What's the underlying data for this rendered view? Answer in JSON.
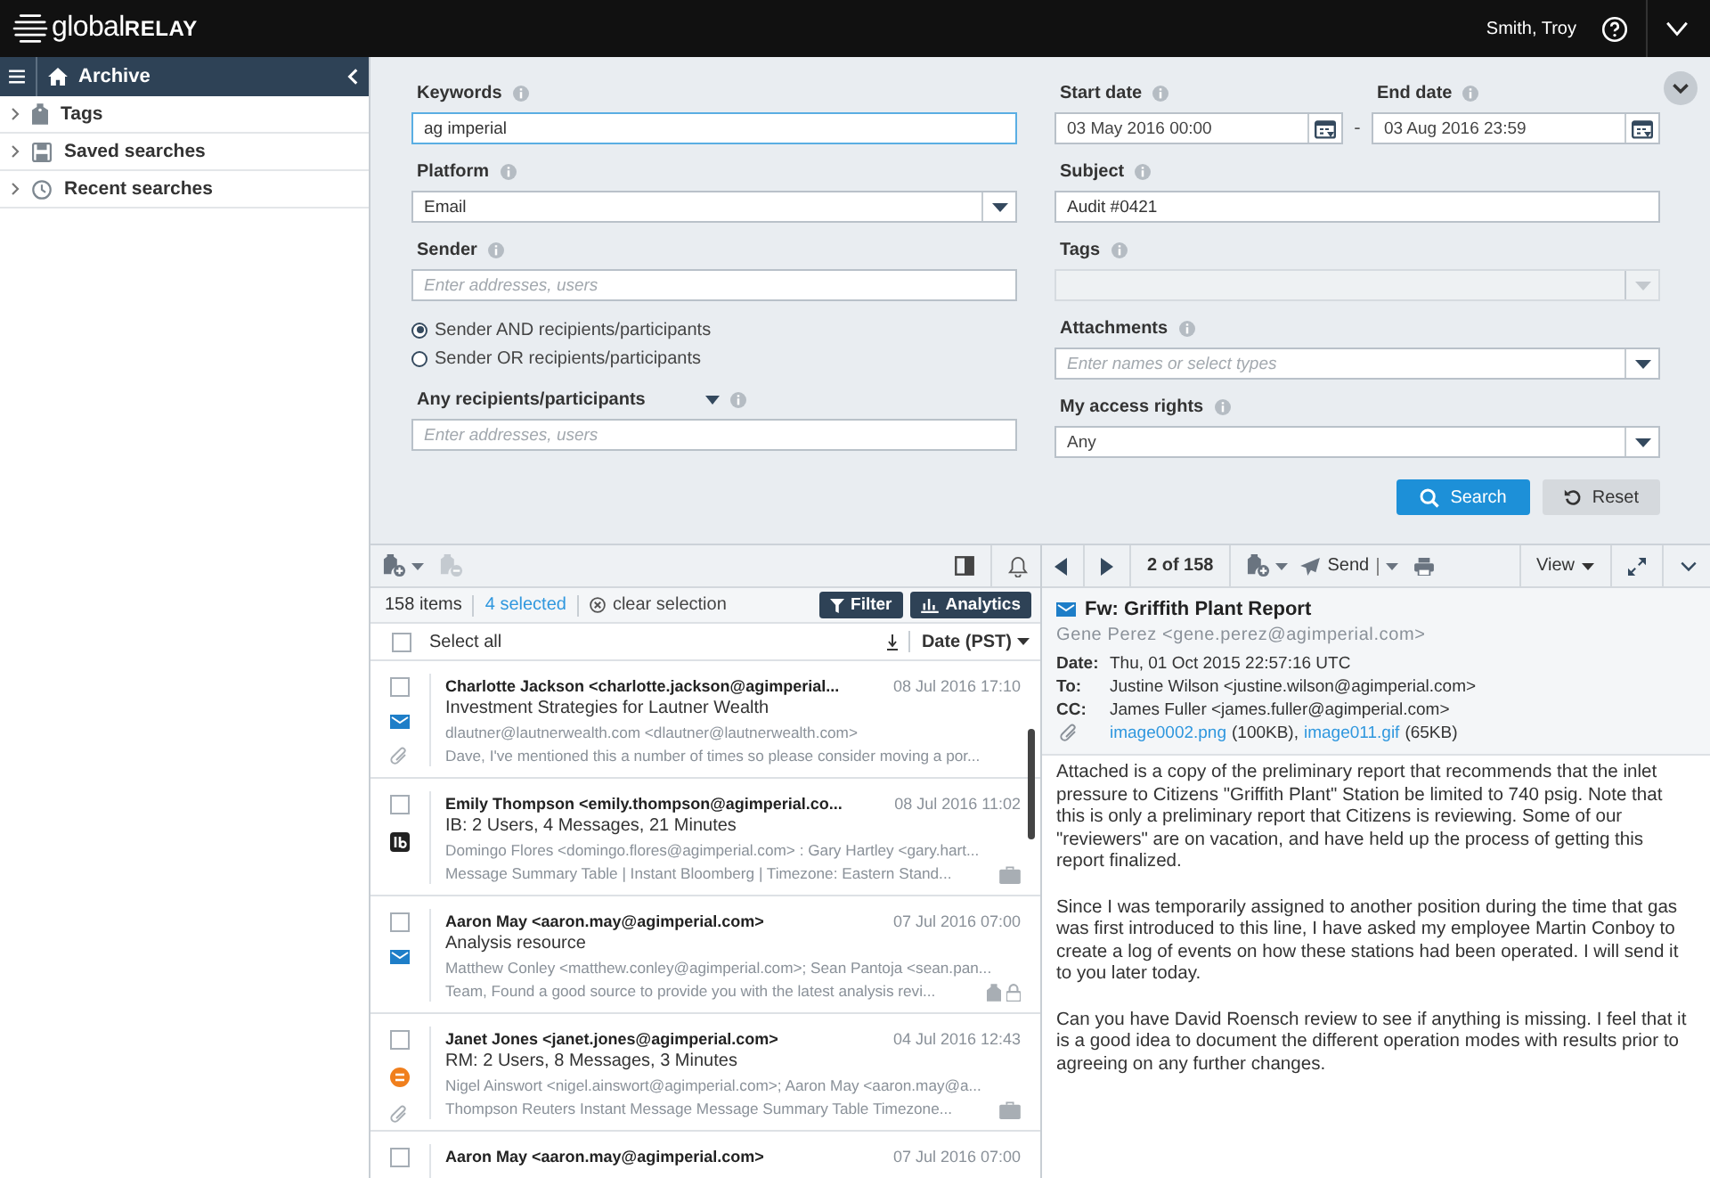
{
  "app": {
    "logo": [
      "global",
      "RELAY"
    ],
    "user": "Smith, Troy"
  },
  "sidebar": {
    "title": "Archive",
    "items": [
      {
        "label": "Tags",
        "kind": "tag",
        "expanded": false
      },
      {
        "label": "Saved searches",
        "kind": "disk",
        "expanded": false
      },
      {
        "label": "Recent searches",
        "kind": "clock",
        "expanded": false
      }
    ]
  },
  "search": {
    "columns": [
      [
        {
          "kind": "text",
          "label": "Keywords",
          "value": "ag imperial",
          "focused": true
        },
        {
          "kind": "select",
          "label": "Platform",
          "value": "Email",
          "disabled": false
        },
        {
          "kind": "text",
          "label": "Sender",
          "placeholder": "Enter addresses, users",
          "focused": false
        },
        {
          "kind": "radios",
          "options": [
            {
              "label": "Sender AND recipients/participants",
              "selected": true
            },
            {
              "label": "Sender OR recipients/participants",
              "selected": false
            }
          ]
        },
        {
          "kind": "text",
          "label": "Any recipients/participants",
          "placeholder": "Enter addresses, users",
          "focused": false,
          "label_menu": true
        }
      ],
      [
        {
          "kind": "dates",
          "separator": "-",
          "items": [
            {
              "label": "Start date",
              "value": "03 May 2016 00:00"
            },
            {
              "label": "End date",
              "value": "03 Aug 2016 23:59"
            }
          ]
        },
        {
          "kind": "text",
          "label": "Subject",
          "value": "Audit #0421",
          "focused": false
        },
        {
          "kind": "select",
          "label": "Tags",
          "disabled": true
        },
        {
          "kind": "select",
          "label": "Attachments",
          "placeholder": "Enter names or select types",
          "disabled": false
        },
        {
          "kind": "select",
          "label": "My access rights",
          "value": "Any",
          "disabled": false
        }
      ]
    ],
    "buttons": [
      {
        "kind": "search",
        "label": "Search"
      },
      {
        "kind": "reset",
        "label": "Reset"
      }
    ]
  },
  "list": {
    "count": "158 items",
    "selected_count": "4 selected",
    "clear": "clear selection",
    "filter": "Filter",
    "analytics": "Analytics",
    "select_all": {
      "label": "Select all",
      "checked": false
    },
    "sort": "Date (PST)",
    "rows": [
      {
        "kind": "email",
        "checked": false,
        "attachment": true,
        "sender": "Charlotte Jackson <charlotte.jackson@agimperial...",
        "date": "08 Jul 2016 17:10",
        "subject": "Investment Strategies for Lautner Wealth",
        "recipients": "dlautner@lautnerwealth.com <dlautner@lautnerwealth.com>",
        "preview": "Dave, I've mentioned this a number of times so please consider moving a por...",
        "markers": []
      },
      {
        "kind": "chat",
        "checked": false,
        "attachment": false,
        "sender": "Emily Thompson <emily.thompson@agimperial.co...",
        "date": "08 Jul 2016 11:02",
        "subject": "IB: 2 Users, 4 Messages, 21 Minutes",
        "recipients": "Domingo Flores <domingo.flores@agimperial.com> : Gary Hartley <gary.hart...",
        "preview": "Message Summary Table | Instant Bloomberg | Timezone: Eastern Stand...",
        "markers": [
          {
            "kind": "briefcase"
          }
        ]
      },
      {
        "kind": "email",
        "checked": false,
        "attachment": false,
        "sender": "Aaron May <aaron.may@agimperial.com>",
        "date": "07 Jul 2016 07:00",
        "subject": "Analysis resource",
        "recipients": "Matthew Conley <matthew.conley@agimperial.com>; Sean Pantoja <sean.pan...",
        "preview": "Team, Found a good source to provide you with the latest analysis revi...",
        "markers": [
          {
            "kind": "tag"
          },
          {
            "kind": "lock"
          }
        ]
      },
      {
        "kind": "circle",
        "checked": false,
        "attachment": true,
        "sender": "Janet Jones <janet.jones@agimperial.com>",
        "date": "04 Jul 2016 12:43",
        "subject": "RM: 2 Users, 8 Messages, 3 Minutes",
        "recipients": "Nigel Ainswort <nigel.ainswort@agimperial.com>; Aaron May <aaron.may@a...",
        "preview": "Thompson Reuters Instant Message Message Summary Table Timezone...",
        "markers": [
          {
            "kind": "briefcase"
          }
        ]
      },
      {
        "checked": false,
        "sender": "Aaron May <aaron.may@agimperial.com>",
        "date": "07 Jul 2016 07:00"
      }
    ]
  },
  "reader": {
    "position": "2 of 158",
    "send": "Send",
    "view": "View",
    "subject": "Fw: Griffith Plant Report",
    "from": "Gene Perez <gene.perez@agimperial.com>",
    "meta": [
      {
        "label": "Date:",
        "value": "Thu, 01 Oct 2015 22:57:16 UTC"
      },
      {
        "label": "To:",
        "value": "Justine Wilson <justine.wilson@agimperial.com>"
      },
      {
        "label": "CC:",
        "value": "James Fuller <james.fuller@agimperial.com>"
      }
    ],
    "attachments": [
      {
        "name": "image0002.png",
        "size": "(100KB),"
      },
      {
        "name": "image011.gif",
        "size": "(65KB)"
      }
    ],
    "body": [
      "Attached is a copy of the preliminary report that recommends that the inlet pressure to Citizens \"Griffith Plant\" Station be limited to 740 psig. Note that this is only a preliminary report that Citizens is reviewing. Some of our \"reviewers\" are on vacation, and have held up the process of getting this report finalized.",
      "Since I was temporarily assigned to another position during the time that gas was first introduced to this line, I have asked my employee Martin Conboy to create a log of events on how these stations had been operated. I will send it to you later today.",
      "Can you have David Roensch review to see if anything is missing. I feel that it is a good idea to document the different operation modes with results prior to agreeing on any further changes."
    ]
  }
}
